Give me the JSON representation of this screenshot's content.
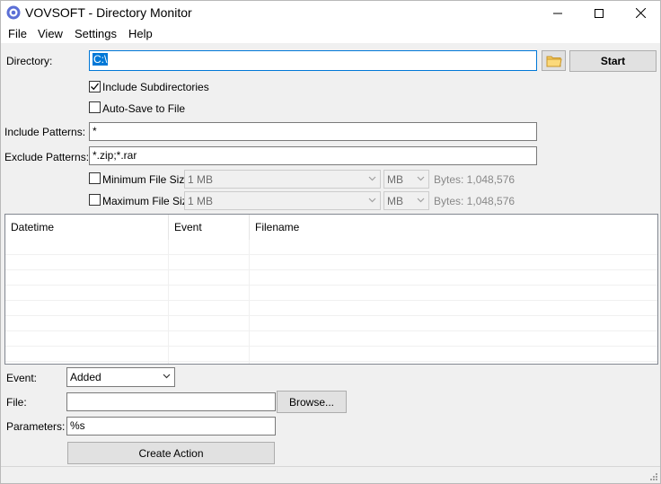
{
  "window": {
    "title": "VOVSOFT - Directory Monitor"
  },
  "menu": [
    "File",
    "View",
    "Settings",
    "Help"
  ],
  "directory": {
    "label": "Directory:",
    "value": "C:\\",
    "start_label": "Start"
  },
  "options": {
    "include_subdirectories": {
      "label": "Include Subdirectories",
      "checked": true
    },
    "auto_save": {
      "label": "Auto-Save to File",
      "checked": false
    }
  },
  "patterns": {
    "include_label": "Include Patterns:",
    "include_value": "*",
    "exclude_label": "Exclude Patterns:",
    "exclude_value": "*.zip;*.rar"
  },
  "size_filters": {
    "min": {
      "label": "Minimum File Size:",
      "value": "1 MB",
      "unit": "MB",
      "bytes": "Bytes:  1,048,576",
      "checked": false
    },
    "max": {
      "label": "Maximum File Size:",
      "value": "1 MB",
      "unit": "MB",
      "bytes": "Bytes:  1,048,576",
      "checked": false
    }
  },
  "table": {
    "columns": [
      "Datetime",
      "Event",
      "Filename"
    ],
    "rows": []
  },
  "action": {
    "event_label": "Event:",
    "event_value": "Added",
    "file_label": "File:",
    "file_value": "",
    "browse_label": "Browse...",
    "parameters_label": "Parameters:",
    "parameters_value": "%s",
    "create_label": "Create Action"
  }
}
